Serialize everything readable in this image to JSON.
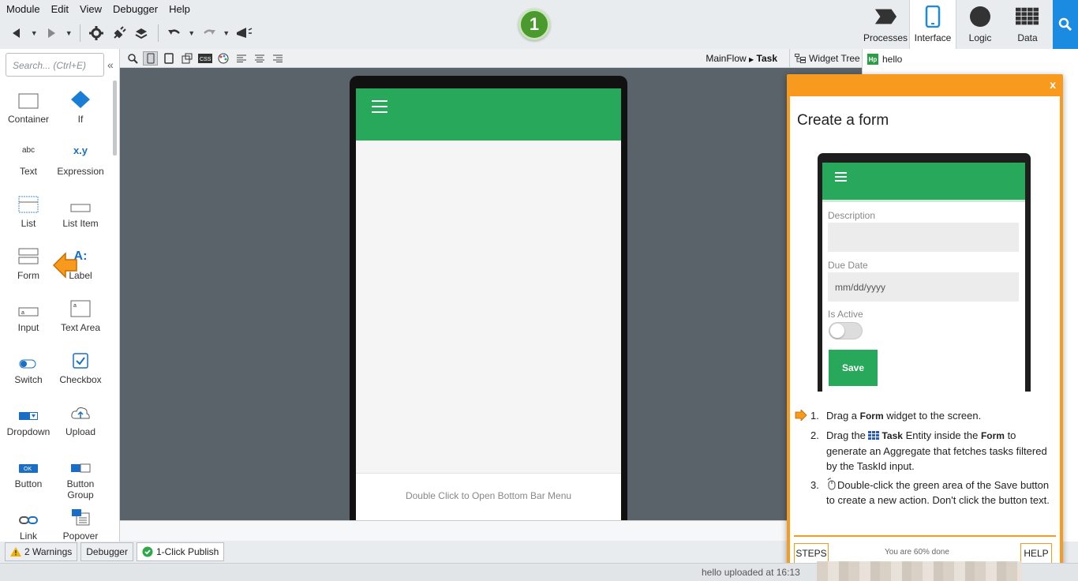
{
  "menu": [
    "Module",
    "Edit",
    "View",
    "Debugger",
    "Help"
  ],
  "step_badge": "1",
  "top_tabs": [
    {
      "label": "Processes",
      "icon": "processes-icon"
    },
    {
      "label": "Interface",
      "icon": "mobile-icon"
    },
    {
      "label": "Logic",
      "icon": "logic-icon"
    },
    {
      "label": "Data",
      "icon": "data-icon"
    }
  ],
  "sidebar": {
    "search_placeholder": "Search... (Ctrl+E)",
    "widgets": [
      "Container",
      "If",
      "Text",
      "Expression",
      "List",
      "List Item",
      "Form",
      "Label",
      "Input",
      "Text Area",
      "Switch",
      "Checkbox",
      "Dropdown",
      "Upload",
      "Button",
      "Button Group",
      "Link",
      "Popover"
    ]
  },
  "canvas_toolbar": {
    "breadcrumb_flow": "MainFlow",
    "breadcrumb_screen": "Task",
    "widget_tree": "Widget Tree"
  },
  "phone": {
    "bottom_bar_text": "Double Click to Open Bottom Bar Menu"
  },
  "right_panel": {
    "tree_root": "hello"
  },
  "tutorial": {
    "close": "x",
    "title": "Create a form",
    "mini": {
      "description_label": "Description",
      "due_date_label": "Due Date",
      "due_date_placeholder": "mm/dd/yyyy",
      "is_active_label": "Is Active",
      "save_label": "Save"
    },
    "steps": [
      {
        "num": "1.",
        "pre": "Drag a ",
        "bold": "Form",
        "post": " widget to the screen."
      },
      {
        "num": "2.",
        "pre": "Drag the ",
        "bold": "Task",
        "mid": " Entity inside the ",
        "bold2": "Form",
        "post": " to generate an Aggregate that fetches tasks filtered by the TaskId input."
      },
      {
        "num": "3.",
        "text": "Double-click the green area of the Save button to create a new action. Don't click the button text."
      }
    ],
    "steps_button": "STEPS",
    "progress": "You are 60% done",
    "help_button": "HELP"
  },
  "bottom_tabs": [
    "2 Warnings",
    "Debugger",
    "1-Click Publish"
  ],
  "status": "hello uploaded at 16:13",
  "colors": {
    "accent_green": "#27a85a",
    "tutorial_orange": "#f79a1e",
    "search_blue": "#1a8be0",
    "interface_blue": "#1a8be0"
  }
}
